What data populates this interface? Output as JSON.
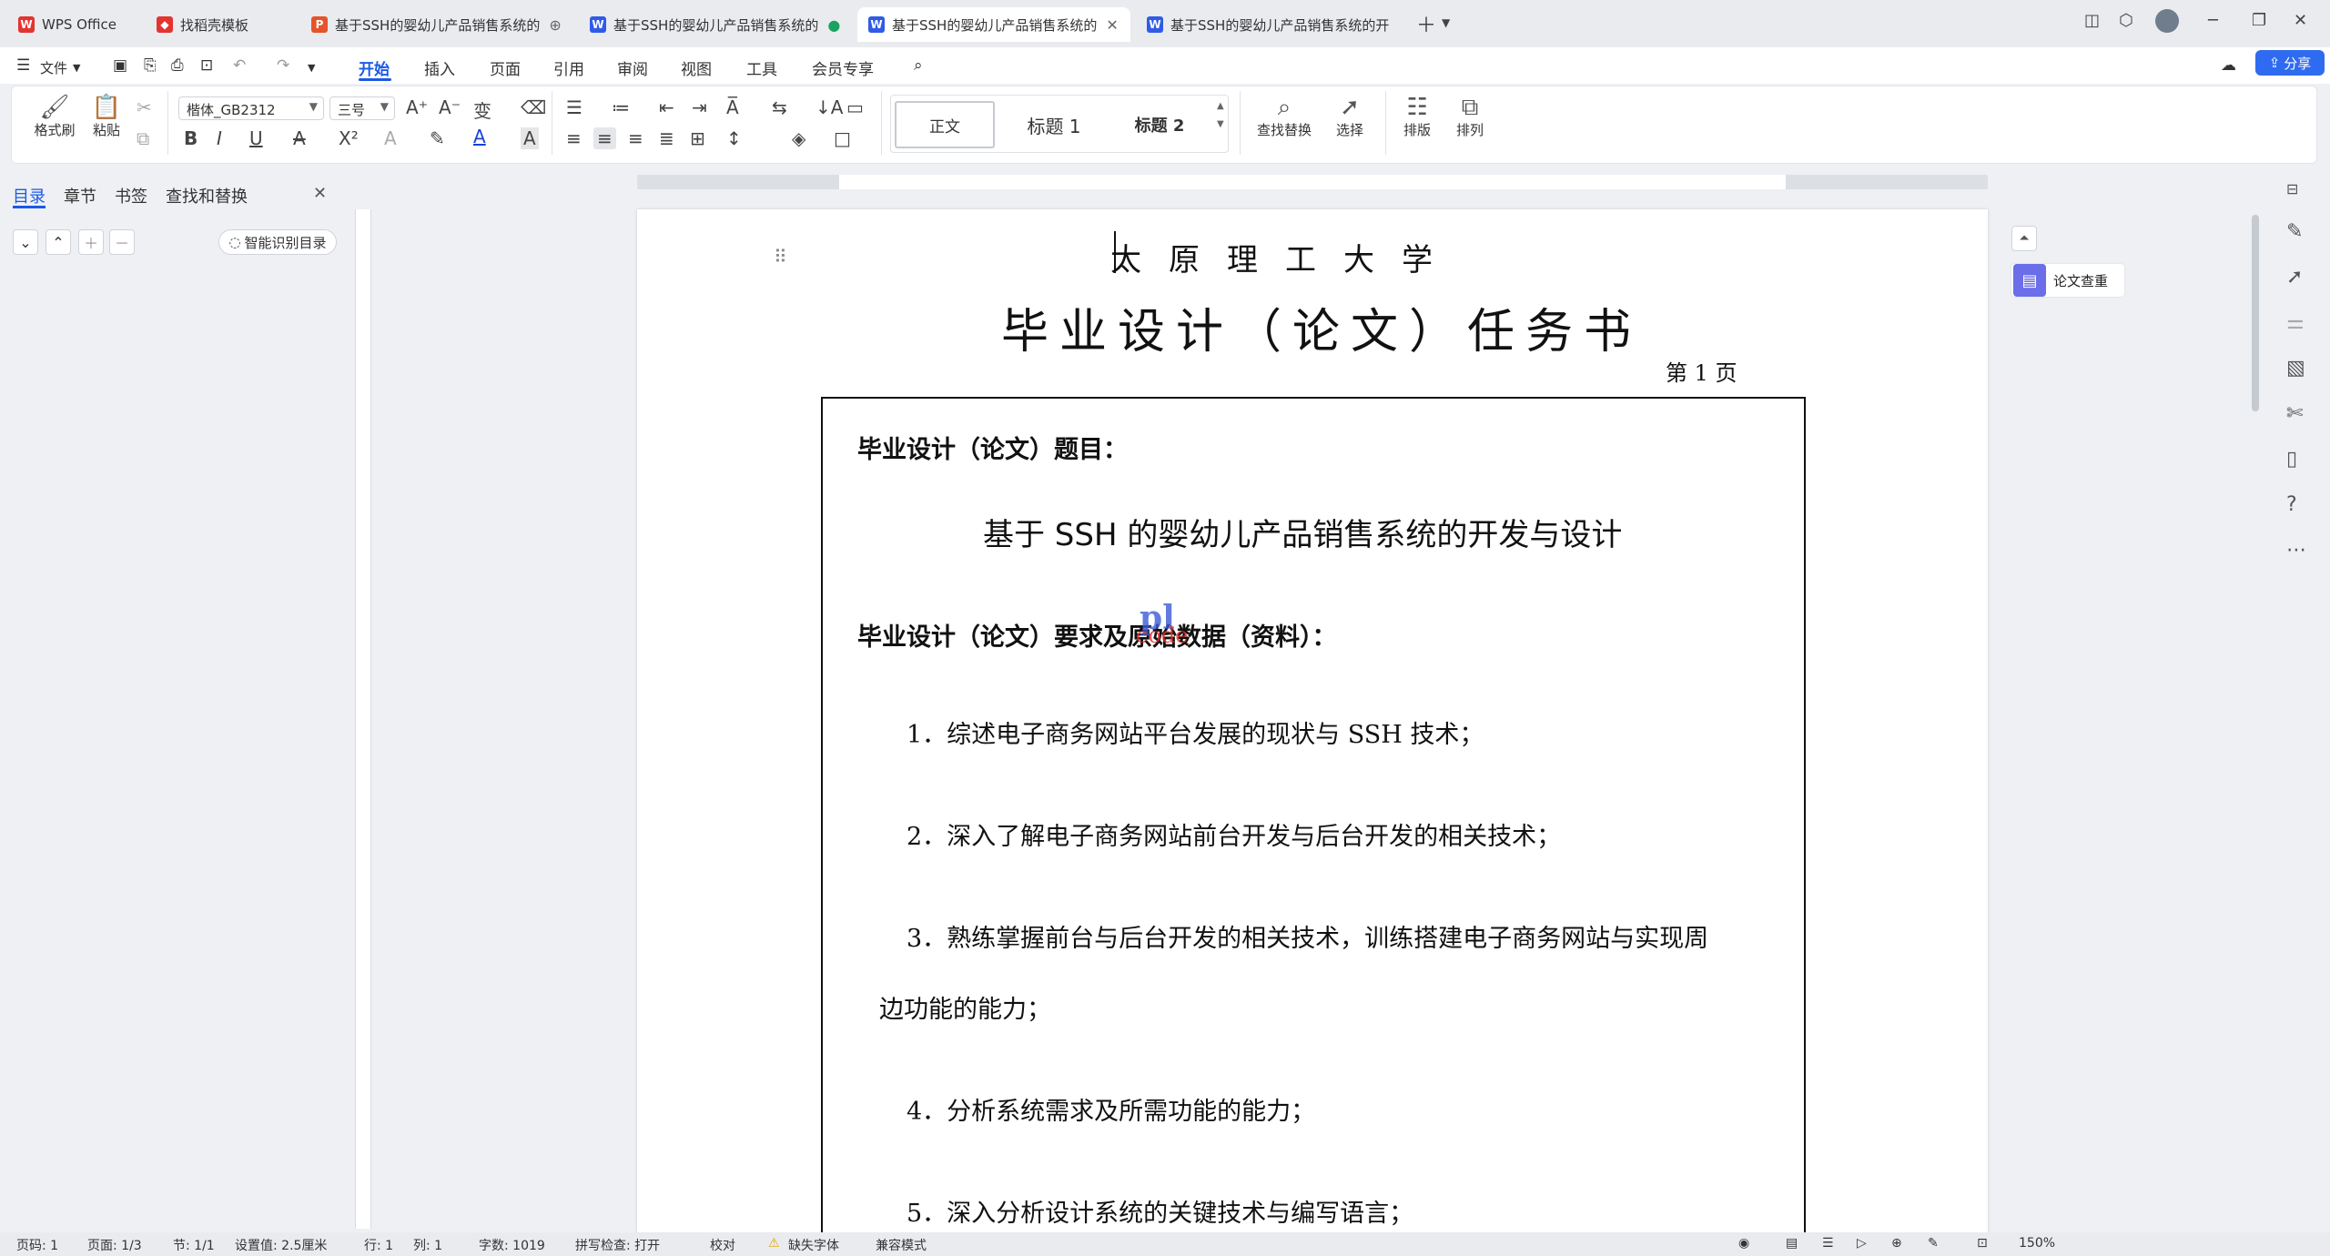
{
  "tabs": [
    {
      "label": "WPS Office",
      "icon": "wps-logo-icon",
      "color": "#e3342f"
    },
    {
      "label": "找稻壳模板",
      "icon": "daoke-icon",
      "color": "#e3342f"
    },
    {
      "label": "基于SSH的婴幼儿产品销售系统的",
      "icon": "ppt-icon",
      "color": "#e5542a"
    },
    {
      "label": "基于SSH的婴幼儿产品销售系统的",
      "icon": "word-icon",
      "color": "#2f5be6"
    },
    {
      "label": "基于SSH的婴幼儿产品销售系统的",
      "icon": "word-icon",
      "color": "#2f5be6"
    },
    {
      "label": "基于SSH的婴幼儿产品销售系统的开",
      "icon": "word-icon",
      "color": "#2f5be6"
    }
  ],
  "menu": {
    "file": "文件",
    "items": [
      "开始",
      "插入",
      "页面",
      "引用",
      "审阅",
      "视图",
      "工具",
      "会员专享"
    ],
    "share": "分享"
  },
  "ribbon": {
    "format_painter": "格式刷",
    "paste": "粘贴",
    "font_name": "楷体_GB2312",
    "font_size": "三号",
    "styles": {
      "normal": "正文",
      "heading1": "标题 1",
      "heading2": "标题 2"
    },
    "find_replace": "查找替换",
    "select": "选择",
    "layout": "排版",
    "arrange": "排列"
  },
  "nav": {
    "tabs": [
      "目录",
      "章节",
      "书签",
      "查找和替换"
    ],
    "smart_toc": "智能识别目录"
  },
  "document": {
    "university": "太原理工大学",
    "title": "毕业设计（论文）任务书",
    "page_no": "第 1 页",
    "topic_label": "毕业设计（论文）题目：",
    "topic": "基于 SSH 的婴幼儿产品销售系统的开发与设计",
    "req_label": "毕业设计（论文）要求及原始数据（资料）：",
    "items": [
      "1．综述电子商务网站平台发展的现状与 SSH 技术；",
      "2．深入了解电子商务网站前台开发与后台开发的相关技术；",
      "3．熟练掌握前台与后台开发的相关技术，训练搭建电子商务网站与实现周",
      "边功能的能力；",
      "4．分析系统需求及所需功能的能力；",
      "5．深入分析设计系统的关键技术与编写语言；"
    ],
    "watermark_top": "pl",
    "watermark_bottom": "code"
  },
  "right_panel": {
    "paper_check": "论文查重"
  },
  "status": {
    "page": "页码: 1",
    "pages": "页面: 1/3",
    "section": "节: 1/1",
    "setting": "设置值: 2.5厘米",
    "row": "行: 1",
    "col": "列: 1",
    "words": "字数: 1019",
    "spell": "拼写检查: 打开",
    "proof": "校对",
    "missing_font": "缺失字体",
    "compat": "兼容模式",
    "zoom": "150%"
  }
}
